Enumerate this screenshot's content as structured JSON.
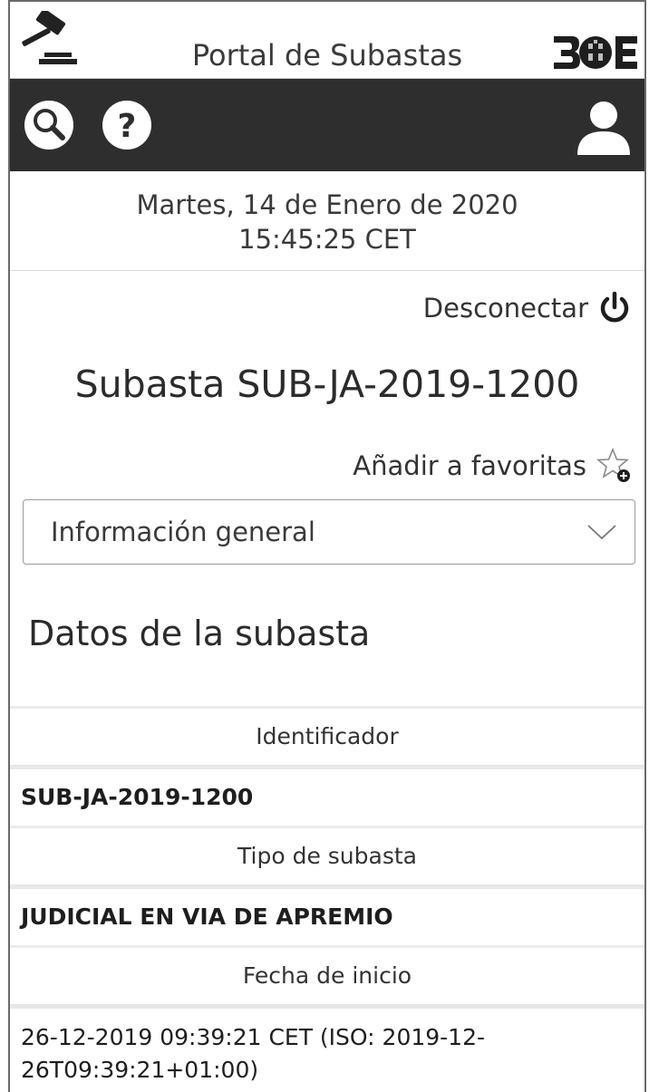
{
  "header": {
    "title": "Portal de Subastas",
    "logo_left_icon": "gavel-icon",
    "logo_right_icon": "boe-logo"
  },
  "toolbar": {
    "search_icon": "search-icon",
    "help_icon": "help-icon",
    "user_icon": "user-icon"
  },
  "datetime": {
    "date": "Martes, 14 de Enero de 2020",
    "time": "15:45:25 CET"
  },
  "session": {
    "logout_label": "Desconectar"
  },
  "auction": {
    "title": "Subasta SUB-JA-2019-1200",
    "favorites_label": "Añadir a favoritas",
    "section_select": "Información general"
  },
  "details": {
    "heading": "Datos de la subasta",
    "fields": [
      {
        "label": "Identificador",
        "value": "SUB-JA-2019-1200"
      },
      {
        "label": "Tipo de subasta",
        "value": "JUDICIAL EN VIA DE APREMIO"
      },
      {
        "label": "Fecha de inicio",
        "value": "26-12-2019 09:39:21 CET (ISO: 2019-12-26T09:39:21+01:00)"
      }
    ]
  },
  "colors": {
    "toolbar_bg": "#2e2e2e",
    "text": "#2b2b2b"
  }
}
